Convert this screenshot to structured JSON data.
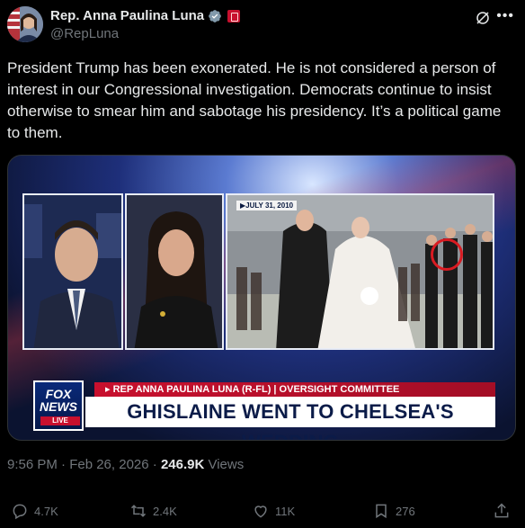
{
  "author": {
    "display_name": "Rep. Anna Paulina Luna",
    "handle": "@RepLuna"
  },
  "tweet": {
    "text": "President Trump has been exonerated. He is not considered a person of interest in our Congressional investigation. Democrats continue to insist otherwise to smear him and sabotage his presidency. It’s a political game to them."
  },
  "media": {
    "date_tag": "▶JULY 31, 2010",
    "network_logo": "FOX NEWS",
    "live_label": "LIVE",
    "subline": "▸ REP ANNA PAULINA LUNA (R-FL) | OVERSIGHT COMMITTEE",
    "headline": "GHISLAINE WENT TO CHELSEA'S WEDDING"
  },
  "meta": {
    "timestamp": "9:56 PM · Feb 26, 2026 · ",
    "views_count": "246.9K",
    "views_label": " Views"
  },
  "actions": {
    "replies": "4.7K",
    "reposts": "2.4K",
    "likes": "11K",
    "bookmarks": "276"
  },
  "icons": {
    "verified": "verified-badge-icon",
    "gov": "government-badge-icon",
    "grok": "grok-icon",
    "more": "more-icon",
    "reply": "reply-icon",
    "repost": "repost-icon",
    "like": "like-icon",
    "bookmark": "bookmark-icon",
    "share": "share-icon"
  },
  "colors": {
    "background": "#000000",
    "text": "#e7e9ea",
    "muted": "#71767b",
    "verified": "#1d9bf0",
    "fox_red": "#c8102e",
    "fox_blue": "#0a2a7a"
  }
}
